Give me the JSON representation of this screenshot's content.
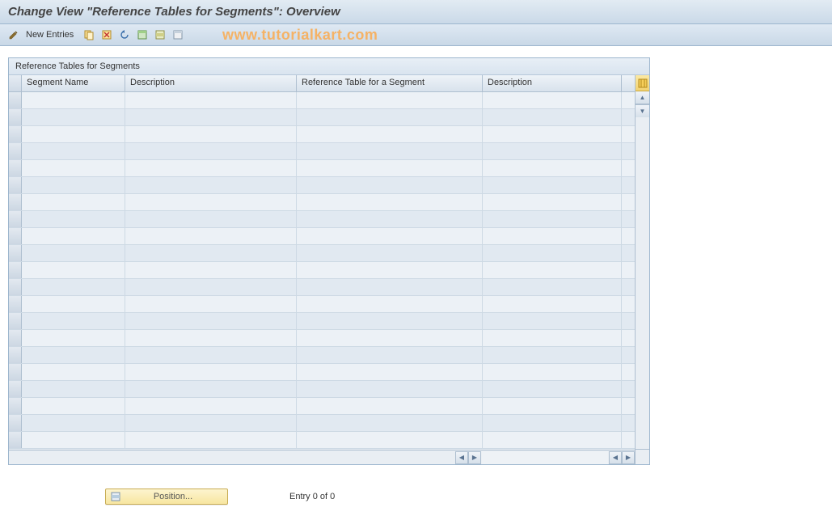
{
  "title": "Change View \"Reference Tables for Segments\": Overview",
  "watermark": "www.tutorialkart.com",
  "toolbar": {
    "new_entries_label": "New Entries",
    "icons": {
      "toggle": "toggle-display-change",
      "copy": "copy",
      "delete": "delete",
      "undo": "undo",
      "select_all": "select-all",
      "select_block": "select-block",
      "deselect_all": "deselect-all"
    }
  },
  "panel": {
    "title": "Reference Tables for Segments",
    "columns": [
      {
        "key": "segment_name",
        "label": "Segment Name"
      },
      {
        "key": "description1",
        "label": "Description"
      },
      {
        "key": "ref_table",
        "label": "Reference Table for a Segment"
      },
      {
        "key": "description2",
        "label": "Description"
      }
    ],
    "rows": [],
    "visible_row_count": 21,
    "config_icon": "table-settings"
  },
  "footer": {
    "position_label": "Position...",
    "entry_status": "Entry 0 of 0"
  }
}
